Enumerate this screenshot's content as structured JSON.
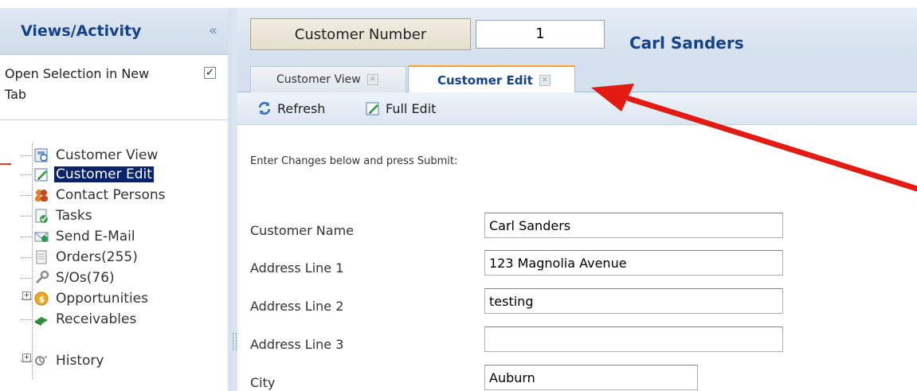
{
  "sidebar": {
    "title": "Views/Activity",
    "collapse_glyph": "«",
    "open_selection_label": "Open Selection in New Tab",
    "open_selection_checked": true,
    "items": [
      {
        "label": "Customer View",
        "icon": "customer-view-icon",
        "selected": false,
        "expandable": false
      },
      {
        "label": "Customer Edit",
        "icon": "edit-icon",
        "selected": true,
        "expandable": false
      },
      {
        "label": "Contact Persons",
        "icon": "contacts-icon",
        "selected": false,
        "expandable": false
      },
      {
        "label": "Tasks",
        "icon": "tasks-icon",
        "selected": false,
        "expandable": false
      },
      {
        "label": "Send E-Mail",
        "icon": "email-icon",
        "selected": false,
        "expandable": false
      },
      {
        "label": "Orders(255)",
        "icon": "document-icon",
        "selected": false,
        "expandable": false
      },
      {
        "label": "S/Os(76)",
        "icon": "wrench-icon",
        "selected": false,
        "expandable": false
      },
      {
        "label": "Opportunities",
        "icon": "coin-icon",
        "selected": false,
        "expandable": true
      },
      {
        "label": "Receivables",
        "icon": "book-icon",
        "selected": false,
        "expandable": false
      },
      {
        "label": "History",
        "icon": "history-icon",
        "selected": false,
        "expandable": true
      }
    ]
  },
  "header": {
    "customer_number_label": "Customer Number",
    "customer_number_value": "1",
    "customer_name": "Carl Sanders"
  },
  "tabs": [
    {
      "label": "Customer View",
      "active": false
    },
    {
      "label": "Customer Edit",
      "active": true
    }
  ],
  "toolbar": {
    "refresh_label": "Refresh",
    "full_edit_label": "Full Edit"
  },
  "form": {
    "instruction": "Enter Changes below and press Submit:",
    "fields": [
      {
        "label": "Customer Name",
        "value": "Carl Sanders"
      },
      {
        "label": "Address Line 1",
        "value": "123 Magnolia Avenue"
      },
      {
        "label": "Address Line 2",
        "value": "testing"
      },
      {
        "label": "Address Line 3",
        "value": ""
      },
      {
        "label": "City",
        "value": "Auburn"
      }
    ]
  },
  "colors": {
    "accent_blue": "#15428b",
    "selection": "#0a246a",
    "annotation_arrow": "#e53b2c",
    "active_tab_top": "#f0a830"
  }
}
